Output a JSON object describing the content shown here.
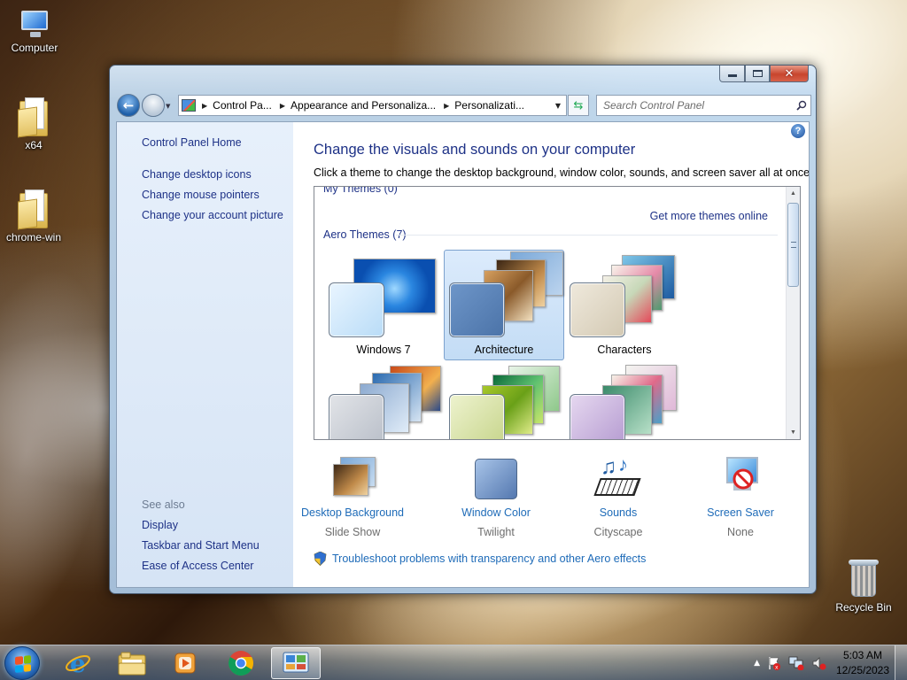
{
  "desktop": {
    "icons": [
      {
        "label": "Computer",
        "icon": "computer-icon"
      },
      {
        "label": "x64",
        "icon": "folder-icon"
      },
      {
        "label": "chrome-win",
        "icon": "folder-icon"
      },
      {
        "label": "Recycle Bin",
        "icon": "recycle-bin-icon"
      }
    ]
  },
  "window": {
    "controls": {
      "minimize": "minimize",
      "maximize": "maximize",
      "close": "close"
    },
    "address": {
      "icon": "control-panel-icon",
      "crumbs": [
        "Control Pa...",
        "Appearance and Personaliza...",
        "Personalizati..."
      ]
    },
    "search": {
      "placeholder": "Search Control Panel"
    }
  },
  "sidebar": {
    "home": "Control Panel Home",
    "links": [
      "Change desktop icons",
      "Change mouse pointers",
      "Change your account picture"
    ],
    "see_also_label": "See also",
    "see_also": [
      "Display",
      "Taskbar and Start Menu",
      "Ease of Access Center"
    ]
  },
  "main": {
    "title": "Change the visuals and sounds on your computer",
    "subtitle": "Click a theme to change the desktop background, window color, sounds, and screen saver all at once.",
    "help_icon": "help-icon",
    "themes": {
      "my_themes_label": "My Themes (0)",
      "get_more": "Get more themes online",
      "aero_label": "Aero Themes (7)",
      "items": [
        {
          "name": "Windows 7",
          "selected": false
        },
        {
          "name": "Architecture",
          "selected": true
        },
        {
          "name": "Characters",
          "selected": false
        },
        {
          "name": "",
          "selected": false
        },
        {
          "name": "",
          "selected": false
        },
        {
          "name": "",
          "selected": false
        }
      ]
    },
    "quick": [
      {
        "label": "Desktop Background",
        "value": "Slide Show",
        "icon": "desktop-background-icon"
      },
      {
        "label": "Window Color",
        "value": "Twilight",
        "icon": "window-color-icon"
      },
      {
        "label": "Sounds",
        "value": "Cityscape",
        "icon": "sounds-icon"
      },
      {
        "label": "Screen Saver",
        "value": "None",
        "icon": "screen-saver-icon"
      }
    ],
    "troubleshoot": "Troubleshoot problems with transparency and other Aero effects"
  },
  "taskbar": {
    "pinned": [
      "internet-explorer-icon",
      "file-explorer-icon",
      "media-player-icon",
      "chrome-icon",
      "control-panel-icon"
    ],
    "active_index": 4,
    "time": "5:03 AM",
    "date": "12/25/2023"
  },
  "colors": {
    "link": "#1e3287",
    "link_secondary": "#1e6bb8",
    "sidebar_bg": "#dfeaf7",
    "selection_bg": "#cfe3f8",
    "selection_border": "#7da2ce"
  }
}
